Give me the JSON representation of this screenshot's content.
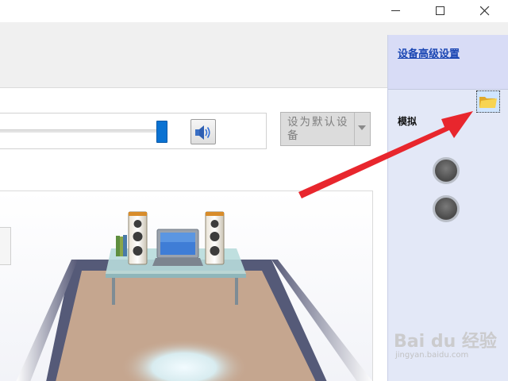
{
  "window": {
    "controls": [
      "minimize",
      "maximize",
      "close"
    ]
  },
  "volume": {
    "level_fraction": 0.97,
    "mute_icon": "speaker-icon"
  },
  "default_button": {
    "label": "设为默认设备"
  },
  "sidebar": {
    "advanced_link": "设备高级设置",
    "folder_icon": "folder-icon",
    "section_label": "模拟",
    "jacks": [
      "jack-1",
      "jack-2"
    ]
  },
  "watermark": {
    "logo": "Bai du 经验",
    "url": "jingyan.baidu.com"
  },
  "colors": {
    "link": "#1a46b3",
    "slider_thumb": "#0a72d2",
    "sidebar_bg": "#e3e8f7",
    "arrow": "#e8262d"
  }
}
